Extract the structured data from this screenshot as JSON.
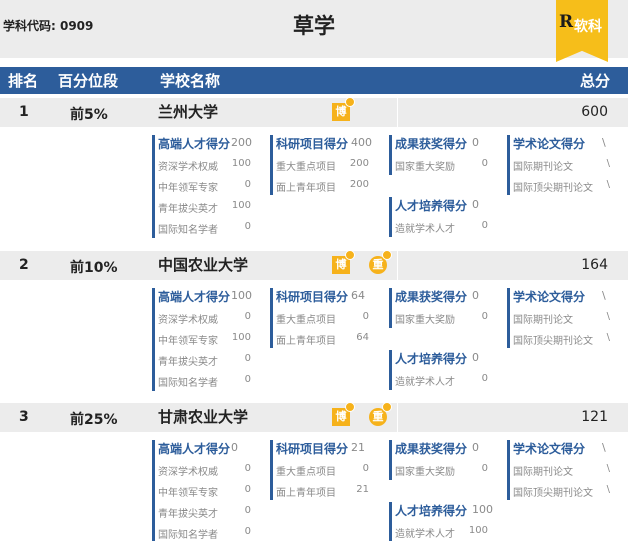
{
  "subject_code": "学科代码: 0909",
  "subject_name": "草学",
  "badge": {
    "logo": "R",
    "label": "软科"
  },
  "table_header": {
    "rank": "排名",
    "percentile": "百分位段",
    "school": "学校名称",
    "total": "总分"
  },
  "rows": [
    {
      "rank": "1",
      "percentile": "前5%",
      "school": "兰州大学",
      "total": "600",
      "tags": [
        "博"
      ],
      "talent": {
        "title": "高端人才得分",
        "value": "200",
        "items": [
          {
            "label": "资深学术权威",
            "value": "100"
          },
          {
            "label": "中年领军专家",
            "value": "0"
          },
          {
            "label": "青年拔尖英才",
            "value": "100"
          },
          {
            "label": "国际知名学者",
            "value": "0"
          }
        ]
      },
      "research": {
        "title": "科研项目得分",
        "value": "400",
        "items": [
          {
            "label": "重大重点项目",
            "value": "200"
          },
          {
            "label": "面上青年项目",
            "value": "200"
          }
        ]
      },
      "awards": {
        "title": "成果获奖得分",
        "value": "0",
        "items": [
          {
            "label": "国家重大奖励",
            "value": "0"
          }
        ]
      },
      "training": {
        "title": "人才培养得分",
        "value": "0",
        "items": [
          {
            "label": "造就学术人才",
            "value": "0"
          }
        ]
      },
      "papers": {
        "title": "学术论文得分",
        "value": "\\",
        "items": [
          {
            "label": "国际期刊论文",
            "value": "\\"
          },
          {
            "label": "国际顶尖期刊论文",
            "value": "\\"
          }
        ]
      }
    },
    {
      "rank": "2",
      "percentile": "前10%",
      "school": "中国农业大学",
      "total": "164",
      "tags": [
        "博",
        "重"
      ],
      "talent": {
        "title": "高端人才得分",
        "value": "100",
        "items": [
          {
            "label": "资深学术权威",
            "value": "0"
          },
          {
            "label": "中年领军专家",
            "value": "100"
          },
          {
            "label": "青年拔尖英才",
            "value": "0"
          },
          {
            "label": "国际知名学者",
            "value": "0"
          }
        ]
      },
      "research": {
        "title": "科研项目得分",
        "value": "64",
        "items": [
          {
            "label": "重大重点项目",
            "value": "0"
          },
          {
            "label": "面上青年项目",
            "value": "64"
          }
        ]
      },
      "awards": {
        "title": "成果获奖得分",
        "value": "0",
        "items": [
          {
            "label": "国家重大奖励",
            "value": "0"
          }
        ]
      },
      "training": {
        "title": "人才培养得分",
        "value": "0",
        "items": [
          {
            "label": "造就学术人才",
            "value": "0"
          }
        ]
      },
      "papers": {
        "title": "学术论文得分",
        "value": "\\",
        "items": [
          {
            "label": "国际期刊论文",
            "value": "\\"
          },
          {
            "label": "国际顶尖期刊论文",
            "value": "\\"
          }
        ]
      }
    },
    {
      "rank": "3",
      "percentile": "前25%",
      "school": "甘肃农业大学",
      "total": "121",
      "tags": [
        "博",
        "重"
      ],
      "talent": {
        "title": "高端人才得分",
        "value": "0",
        "items": [
          {
            "label": "资深学术权威",
            "value": "0"
          },
          {
            "label": "中年领军专家",
            "value": "0"
          },
          {
            "label": "青年拔尖英才",
            "value": "0"
          },
          {
            "label": "国际知名学者",
            "value": "0"
          }
        ]
      },
      "research": {
        "title": "科研项目得分",
        "value": "21",
        "items": [
          {
            "label": "重大重点项目",
            "value": "0"
          },
          {
            "label": "面上青年项目",
            "value": "21"
          }
        ]
      },
      "awards": {
        "title": "成果获奖得分",
        "value": "0",
        "items": [
          {
            "label": "国家重大奖励",
            "value": "0"
          }
        ]
      },
      "training": {
        "title": "人才培养得分",
        "value": "100",
        "items": [
          {
            "label": "造就学术人才",
            "value": "100"
          }
        ]
      },
      "papers": {
        "title": "学术论文得分",
        "value": "\\",
        "items": [
          {
            "label": "国际期刊论文",
            "value": "\\"
          },
          {
            "label": "国际顶尖期刊论文",
            "value": "\\"
          }
        ]
      }
    }
  ]
}
